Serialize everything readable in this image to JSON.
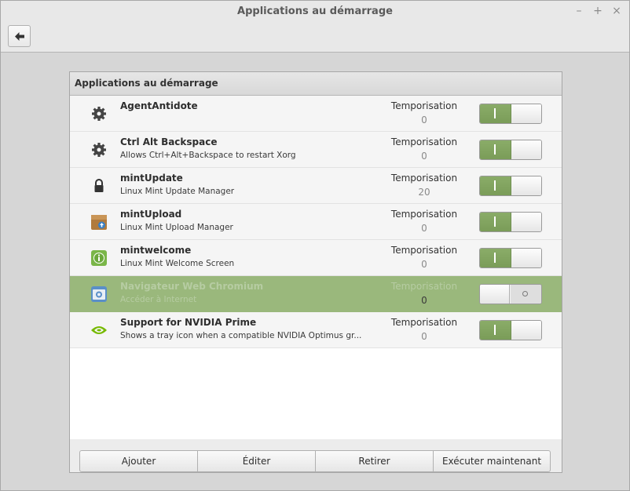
{
  "window": {
    "title": "Applications au démarrage",
    "minimize_glyph": "–",
    "maximize_glyph": "+",
    "close_glyph": "×"
  },
  "panel": {
    "title": "Applications au démarrage"
  },
  "delay_label": "Temporisation",
  "apps": [
    {
      "name": "AgentAntidote",
      "description": "",
      "delay": "0",
      "enabled": true,
      "icon": "gear-icon"
    },
    {
      "name": "Ctrl Alt Backspace",
      "description": "Allows Ctrl+Alt+Backspace to restart Xorg",
      "delay": "0",
      "enabled": true,
      "icon": "gear-icon"
    },
    {
      "name": "mintUpdate",
      "description": "Linux Mint Update Manager",
      "delay": "20",
      "enabled": true,
      "icon": "lock-icon"
    },
    {
      "name": "mintUpload",
      "description": "Linux Mint Upload Manager",
      "delay": "0",
      "enabled": true,
      "icon": "upload-box-icon"
    },
    {
      "name": "mintwelcome",
      "description": "Linux Mint Welcome Screen",
      "delay": "0",
      "enabled": true,
      "icon": "info-icon"
    },
    {
      "name": "Navigateur Web Chromium",
      "description": "Accéder à Internet",
      "delay": "0",
      "enabled": false,
      "selected": true,
      "icon": "chromium-icon"
    },
    {
      "name": "Support for NVIDIA Prime",
      "description": "Shows a tray icon when a compatible NVIDIA Optimus gr...",
      "delay": "0",
      "enabled": true,
      "icon": "nvidia-icon"
    }
  ],
  "buttons": {
    "add": "Ajouter",
    "edit": "Éditer",
    "remove": "Retirer",
    "run_now": "Exécuter maintenant"
  },
  "colors": {
    "accent": "#8aac68",
    "selected_row": "#9ab87c"
  }
}
